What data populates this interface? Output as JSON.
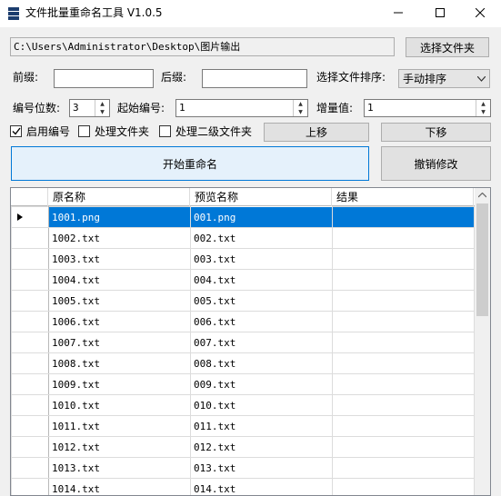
{
  "window": {
    "title": "文件批量重命名工具 V1.0.5",
    "minimize_glyph": "—",
    "maximize_glyph": "☐",
    "close_glyph": "✕"
  },
  "path_bar": {
    "value": "C:\\Users\\Administrator\\Desktop\\图片输出",
    "browse_label": "选择文件夹"
  },
  "options": {
    "prefix_label": "前缀:",
    "prefix_value": "",
    "suffix_label": "后缀:",
    "suffix_value": "",
    "sort_label": "选择文件排序:",
    "sort_value": "手动排序",
    "digits_label": "编号位数:",
    "digits_value": "3",
    "start_label": "起始编号:",
    "start_value": "1",
    "increment_label": "增量值:",
    "increment_value": "1",
    "enable_numbering_label": "启用编号",
    "enable_numbering_checked": true,
    "process_folder_label": "处理文件夹",
    "process_folder_checked": false,
    "process_subfolder_label": "处理二级文件夹",
    "process_subfolder_checked": false,
    "move_up_label": "上移",
    "move_down_label": "下移"
  },
  "actions": {
    "start_label": "开始重命名",
    "undo_label": "撤销修改"
  },
  "table": {
    "columns": [
      "原名称",
      "预览名称",
      "结果"
    ],
    "rows": [
      {
        "original": "1001.png",
        "preview": "001.png",
        "result": ""
      },
      {
        "original": "1002.txt",
        "preview": "002.txt",
        "result": ""
      },
      {
        "original": "1003.txt",
        "preview": "003.txt",
        "result": ""
      },
      {
        "original": "1004.txt",
        "preview": "004.txt",
        "result": ""
      },
      {
        "original": "1005.txt",
        "preview": "005.txt",
        "result": ""
      },
      {
        "original": "1006.txt",
        "preview": "006.txt",
        "result": ""
      },
      {
        "original": "1007.txt",
        "preview": "007.txt",
        "result": ""
      },
      {
        "original": "1008.txt",
        "preview": "008.txt",
        "result": ""
      },
      {
        "original": "1009.txt",
        "preview": "009.txt",
        "result": ""
      },
      {
        "original": "1010.txt",
        "preview": "010.txt",
        "result": ""
      },
      {
        "original": "1011.txt",
        "preview": "011.txt",
        "result": ""
      },
      {
        "original": "1012.txt",
        "preview": "012.txt",
        "result": ""
      },
      {
        "original": "1013.txt",
        "preview": "013.txt",
        "result": ""
      },
      {
        "original": "1014.txt",
        "preview": "014.txt",
        "result": ""
      }
    ],
    "selected_row": 0
  },
  "colors": {
    "selection": "#0078d7",
    "accent_button": "#e5f1fb",
    "accent_border": "#0078d7"
  }
}
